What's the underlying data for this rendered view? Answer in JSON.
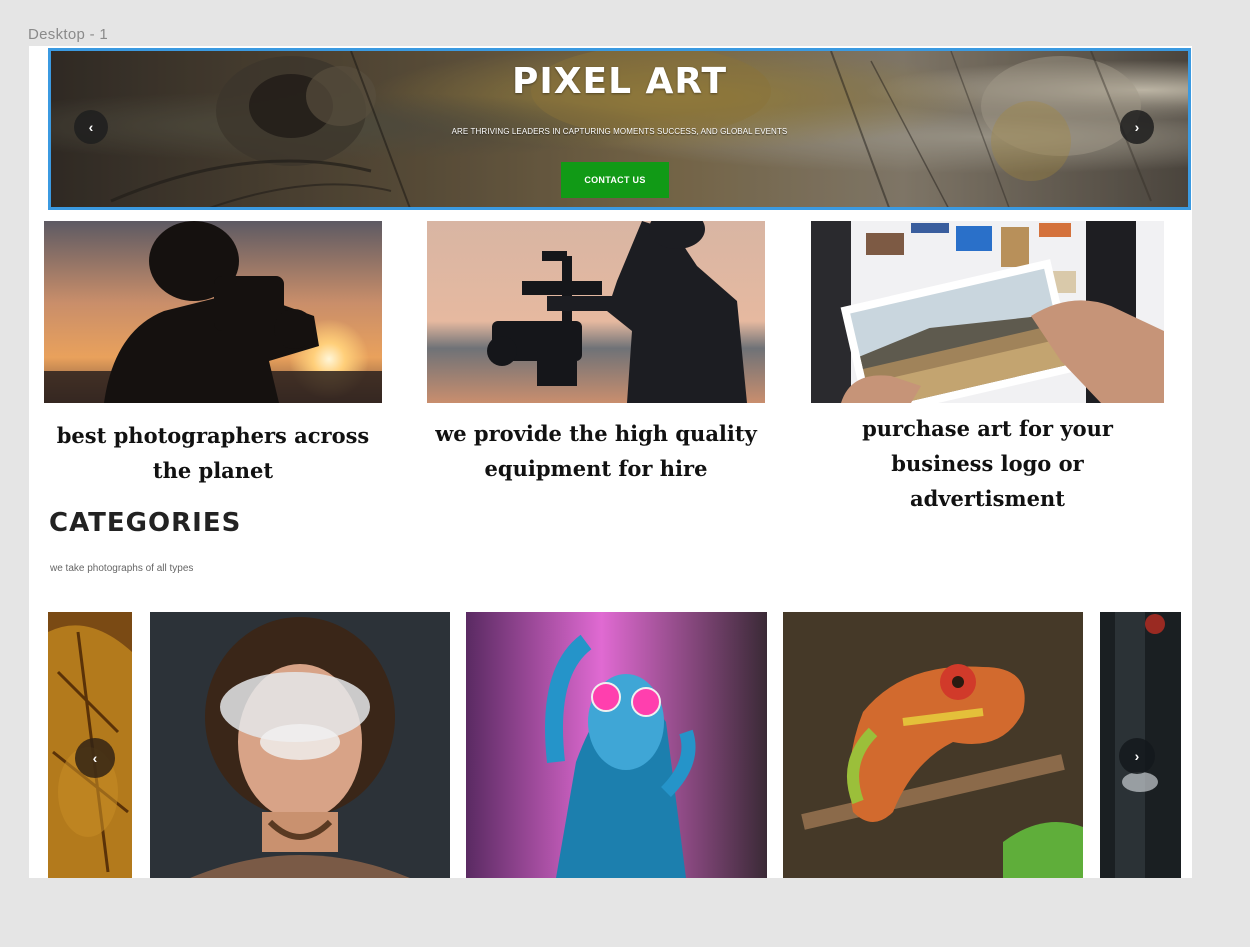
{
  "frame": {
    "label": "Desktop - 1"
  },
  "hero": {
    "title": "PIXEL ART",
    "subtitle": "ARE THRIVING LEADERS IN CAPTURING MOMENTS SUCCESS, AND GLOBAL EVENTS",
    "button_label": "CONTACT US",
    "prev_icon": "chevron-left-icon",
    "next_icon": "chevron-right-icon",
    "prev_glyph": "‹",
    "next_glyph": "›",
    "button_color": "#119a16",
    "selection_color": "#3b9ae1"
  },
  "features": [
    {
      "text": "best photographers across the planet",
      "image": "photographer-sunset-silhouette"
    },
    {
      "text": "we provide the high quality equipment for hire",
      "image": "camera-gimbal-silhouette"
    },
    {
      "text": "purchase art for your business logo or advertisment",
      "image": "hands-holding-landscape-print"
    }
  ],
  "categories": {
    "title": "CATEGORIES",
    "subtitle": "we take photographs of all types",
    "prev_glyph": "‹",
    "next_glyph": "›",
    "images": [
      "autumn-leaf",
      "smoke-portrait",
      "neon-glasses-portrait",
      "chameleon",
      "dark-forest"
    ]
  }
}
